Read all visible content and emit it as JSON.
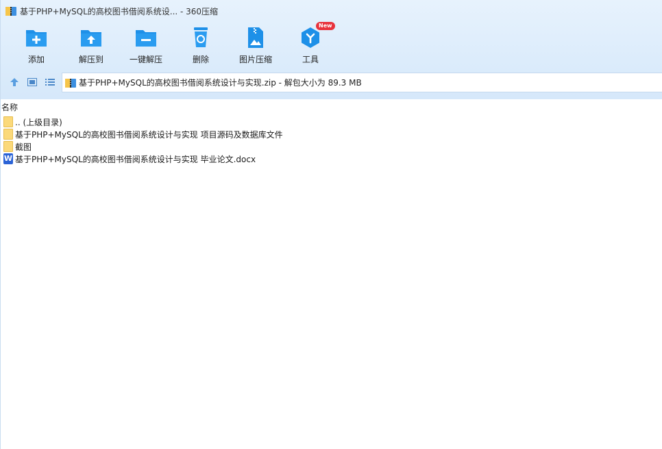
{
  "window": {
    "title": "基于PHP+MySQL的高校图书借阅系统设... - 360压缩"
  },
  "toolbar": {
    "items": [
      {
        "label": "添加",
        "icon": "add-folder-icon"
      },
      {
        "label": "解压到",
        "icon": "extract-to-icon"
      },
      {
        "label": "一键解压",
        "icon": "one-click-extract-icon"
      },
      {
        "label": "删除",
        "icon": "recycle-bin-icon"
      },
      {
        "label": "图片压缩",
        "icon": "image-compress-icon"
      },
      {
        "label": "工具",
        "icon": "tools-icon",
        "badge": "New"
      }
    ]
  },
  "nav": {
    "up_icon": "arrow-up-icon",
    "thumbnail_icon": "thumbnail-view-icon",
    "list_icon": "list-view-icon"
  },
  "address": {
    "text": "基于PHP+MySQL的高校图书借阅系统设计与实现.zip - 解包大小为 89.3 MB"
  },
  "list": {
    "header_name": "名称",
    "rows": [
      {
        "name": ".. (上级目录)",
        "type": "folder"
      },
      {
        "name": "基于PHP+MySQL的高校图书借阅系统设计与实现 项目源码及数据库文件",
        "type": "folder"
      },
      {
        "name": "截图",
        "type": "folder"
      },
      {
        "name": "基于PHP+MySQL的高校图书借阅系统设计与实现 毕业论文.docx",
        "type": "word",
        "icon_letter": "W"
      }
    ]
  },
  "colors": {
    "accent": "#1e90e8",
    "folder": "#fbd97a",
    "word": "#2b63d6",
    "badge": "#e8323c"
  }
}
